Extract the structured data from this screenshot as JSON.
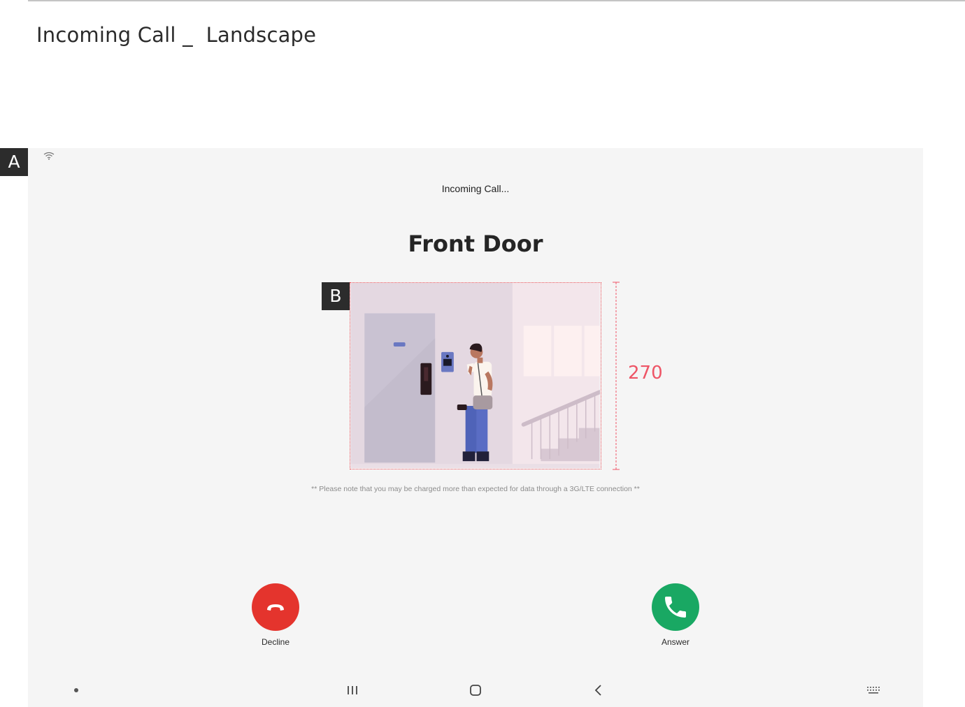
{
  "page": {
    "title": "Incoming Call _  Landscape"
  },
  "markers": {
    "a": "A",
    "b": "B"
  },
  "status_bar": {
    "wifi_icon": "wifi-icon"
  },
  "call": {
    "status": "Incoming Call...",
    "caller_name": "Front Door",
    "notice": "** Please note that you may be charged more than expected for data through a 3G/LTE connection **"
  },
  "preview": {
    "height_annotation": "270"
  },
  "actions": {
    "decline_label": "Decline",
    "answer_label": "Answer",
    "decline_color": "#e4342d",
    "answer_color": "#19a863"
  },
  "navigation": {
    "icons": [
      "dot-icon",
      "recents-icon",
      "home-icon",
      "back-icon",
      "keyboard-icon"
    ]
  },
  "colors": {
    "screen_background": "#f5f5f5",
    "annotation": "#ee5566"
  }
}
